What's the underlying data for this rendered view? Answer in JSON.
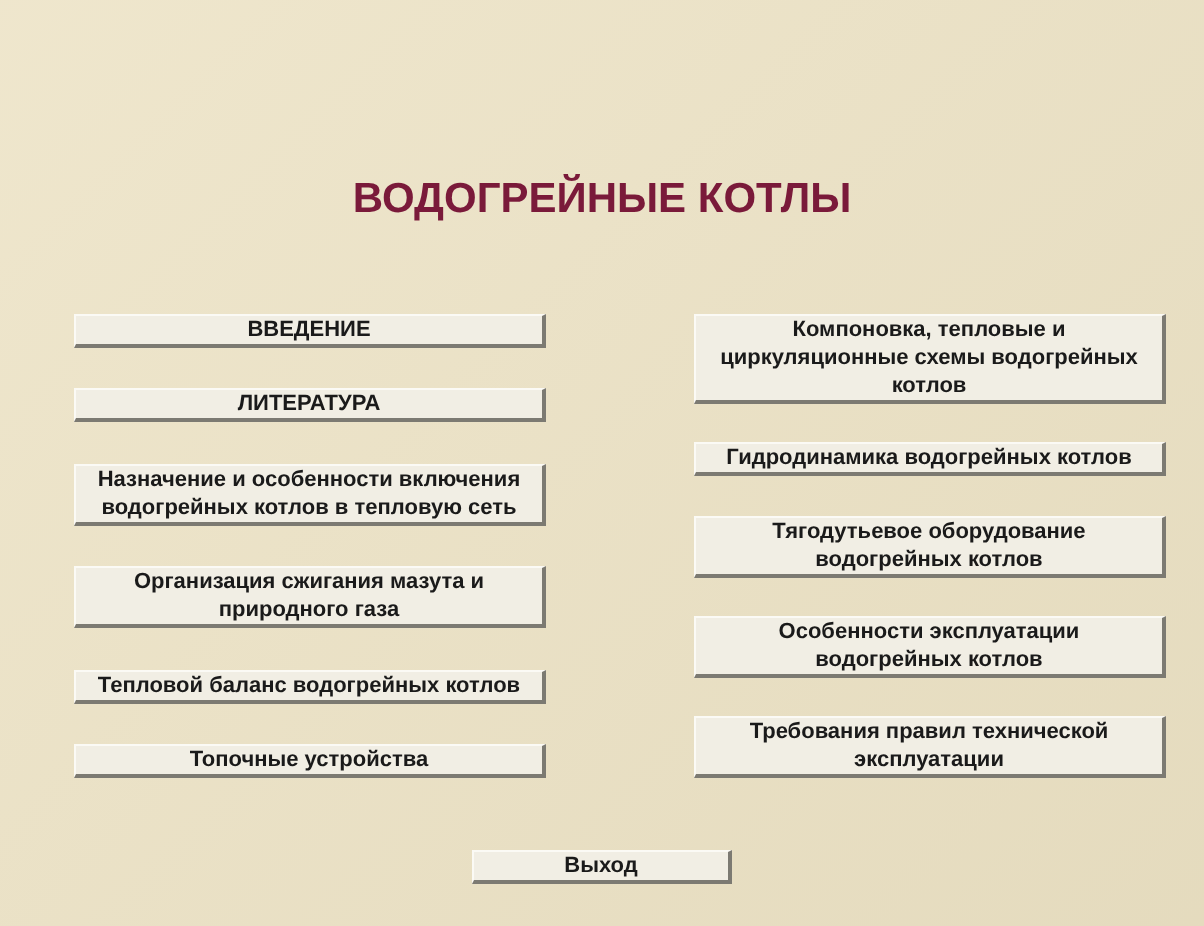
{
  "title": "ВОДОГРЕЙНЫЕ КОТЛЫ",
  "left_menu": [
    {
      "label": "ВВЕДЕНИЕ"
    },
    {
      "label": "ЛИТЕРАТУРА"
    },
    {
      "label": "Назначение и особенности включения водогрейных котлов в тепловую сеть"
    },
    {
      "label": "Организация сжигания мазута и природного газа"
    },
    {
      "label": "Тепловой баланс водогрейных котлов"
    },
    {
      "label": "Топочные устройства"
    }
  ],
  "right_menu": [
    {
      "label": "Компоновка, тепловые и циркуляционные схемы водогрейных котлов"
    },
    {
      "label": "Гидродинамика водогрейных котлов"
    },
    {
      "label": "Тягодутьевое оборудование водогрейных котлов"
    },
    {
      "label": "Особенности эксплуатации водогрейных котлов"
    },
    {
      "label": "Требования правил технической эксплуатации"
    }
  ],
  "exit_button": "Выход"
}
